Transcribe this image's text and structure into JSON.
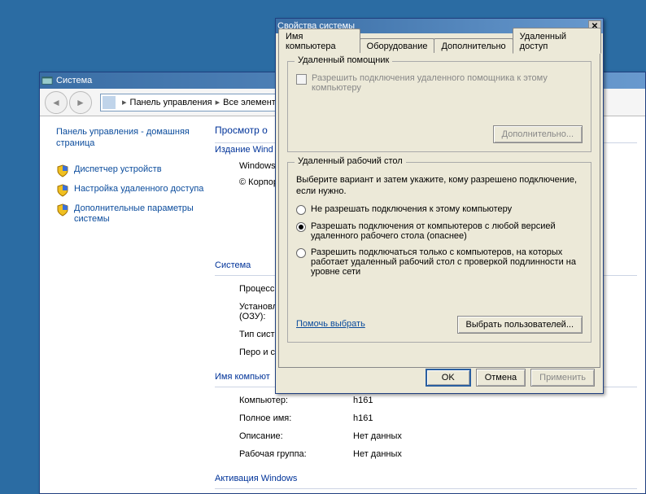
{
  "sysWindow": {
    "title": "Система",
    "breadcrumb": {
      "seg1": "Панель управления",
      "seg2": "Все элемент"
    },
    "leftpane": {
      "homeLink": "Панель управления - домашняя страница",
      "items": [
        "Диспетчер устройств",
        "Настройка удаленного доступа",
        "Дополнительные параметры системы"
      ]
    },
    "right": {
      "heading": "Просмотр о",
      "editionLabel": "Издание Wind",
      "osline": "Windows",
      "copyright": "© Корпор",
      "systemTitle": "Система",
      "rows": [
        {
          "lbl": "Процессо"
        },
        {
          "lbl": "Установл",
          "lbl2": "(ОЗУ):"
        },
        {
          "lbl": "Тип систе"
        },
        {
          "lbl": "Перо и се"
        }
      ],
      "compTitle": "Имя компьют",
      "compRows": [
        {
          "lbl": "Компьютер:",
          "val": "h161"
        },
        {
          "lbl": "Полное имя:",
          "val": "h161"
        },
        {
          "lbl": "Описание:",
          "val": "Нет данных"
        },
        {
          "lbl": "Рабочая группа:",
          "val": "Нет данных"
        }
      ],
      "activationTitle": "Активация Windows"
    }
  },
  "dialog": {
    "title": "Свойства системы",
    "tabs": [
      "Имя компьютера",
      "Оборудование",
      "Дополнительно",
      "Удаленный доступ"
    ],
    "group1": {
      "title": "Удаленный помощник",
      "chkLabel": "Разрешить подключения удаленного помощника к этому компьютеру",
      "moreBtn": "Дополнительно..."
    },
    "group2": {
      "title": "Удаленный рабочий стол",
      "intro": "Выберите вариант и затем укажите, кому разрешено подключение, если нужно.",
      "opt1": "Не разрешать подключения к этому компьютеру",
      "opt2": "Разрешать подключения от компьютеров с любой версией удаленного рабочего стола (опаснее)",
      "opt3": "Разрешить подключаться только с компьютеров, на которых работает удаленный рабочий стол с проверкой подлинности на уровне сети",
      "helpLink": "Помочь выбрать",
      "usersBtn": "Выбрать пользователей..."
    },
    "buttons": {
      "ok": "OK",
      "cancel": "Отмена",
      "apply": "Применить"
    }
  }
}
